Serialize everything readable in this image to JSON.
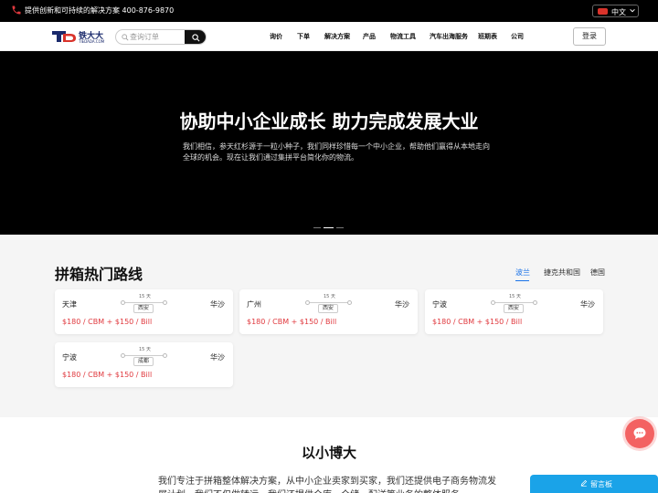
{
  "topbar": {
    "slogan": "提供创新和可持续的解决方案 400-876-9870",
    "language": "中文"
  },
  "nav": {
    "logo_name": "铁大大",
    "logo_sub": "TIEDADA.COM",
    "search_placeholder": "查询订单",
    "menu": [
      "询价",
      "下单",
      "解决方案",
      "产品",
      "物流工具",
      "汽车出海服务",
      "班期表",
      "公司"
    ],
    "login_label": "登录"
  },
  "hero": {
    "title": "协助中小企业成长 助力完成发展大业",
    "description": "我们相信，参天红杉源于一粒小种子，我们同样珍惜每一个中小企业，帮助他们赢得从本地走向全球的机会。现在让我们通过集拼平台简化你的物流。",
    "slide_count": 3,
    "active_slide": 2
  },
  "routes": {
    "title": "拼箱热门路线",
    "tabs": [
      "波兰",
      "捷克共和国",
      "德国"
    ],
    "active_tab": 0,
    "cards": [
      {
        "from": "天津",
        "to": "华沙",
        "days": "15 天",
        "via": "西安",
        "price": "$180 / CBM + $150 / Bill"
      },
      {
        "from": "广州",
        "to": "华沙",
        "days": "15 天",
        "via": "西安",
        "price": "$180 / CBM + $150 / Bill"
      },
      {
        "from": "宁波",
        "to": "华沙",
        "days": "15 天",
        "via": "西安",
        "price": "$180 / CBM + $150 / Bill"
      },
      {
        "from": "宁波",
        "to": "华沙",
        "days": "15 天",
        "via": "成都",
        "price": "$180 / CBM + $150 / Bill"
      }
    ]
  },
  "about": {
    "title": "以小博大",
    "text": "我们专注于拼箱整体解决方案，从中小企业卖家到买家，我们还提供电子商务物流发展计划，我们不仅做转运，我们还提供仓库，仓储，配送等业务的整体服务。"
  },
  "widgets": {
    "message_board": "留言板"
  },
  "colors": {
    "accent_blue": "#1a73e8",
    "price_red": "#e0393e",
    "chat_red": "#f36262",
    "message_blue": "#1aa3e8"
  }
}
